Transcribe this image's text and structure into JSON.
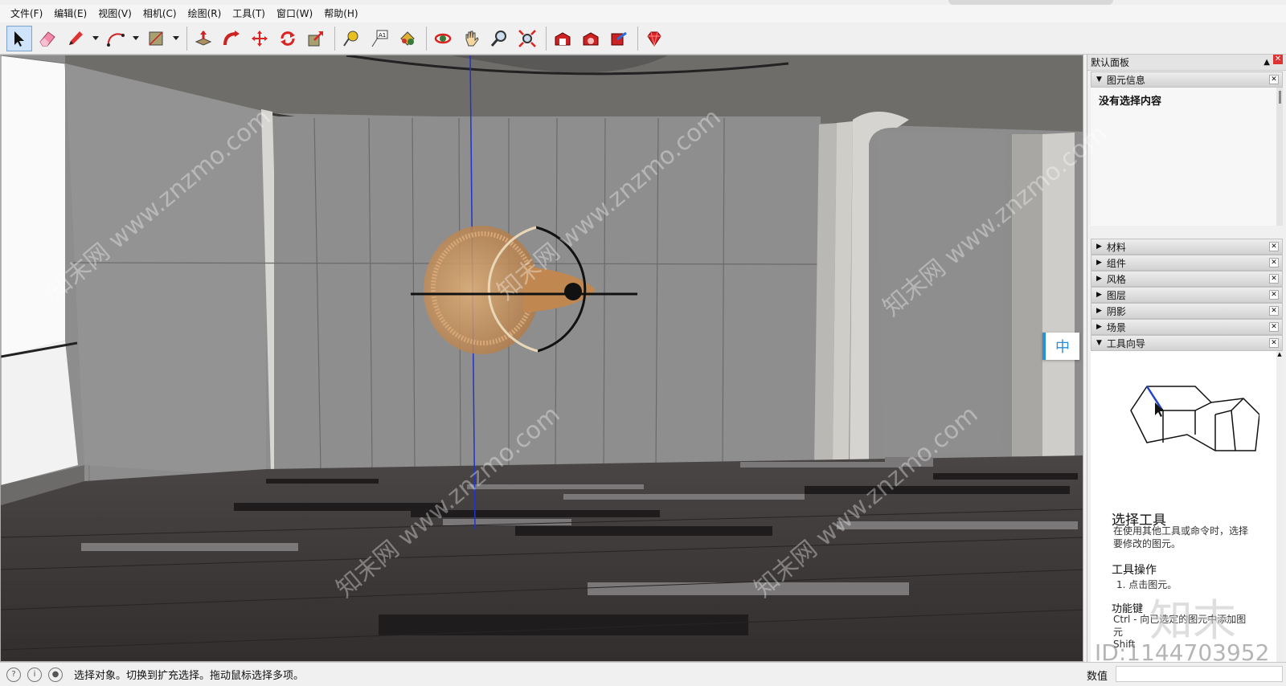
{
  "menu": {
    "items": [
      "文件(F)",
      "编辑(E)",
      "视图(V)",
      "相机(C)",
      "绘图(R)",
      "工具(T)",
      "窗口(W)",
      "帮助(H)"
    ]
  },
  "toolbar": {
    "tools": [
      {
        "name": "select-tool",
        "icon": "arrow-cursor-icon",
        "active": true
      },
      {
        "name": "eraser-tool",
        "icon": "eraser-icon"
      },
      {
        "name": "line-tool",
        "icon": "pencil-icon",
        "dropdown": true
      },
      {
        "name": "arc-tool",
        "icon": "arc-icon",
        "dropdown": true
      },
      {
        "name": "rectangle-tool",
        "icon": "rectangle-icon",
        "dropdown": true
      },
      {
        "name": "push-pull-tool",
        "icon": "push-pull-icon"
      },
      {
        "name": "follow-me-tool",
        "icon": "follow-me-icon"
      },
      {
        "name": "move-tool",
        "icon": "move-icon"
      },
      {
        "name": "rotate-tool",
        "icon": "rotate-icon"
      },
      {
        "name": "scale-tool",
        "icon": "scale-icon"
      },
      {
        "name": "tape-measure-tool",
        "icon": "tape-measure-icon"
      },
      {
        "name": "text-tool",
        "icon": "text-icon"
      },
      {
        "name": "paint-bucket-tool",
        "icon": "paint-bucket-icon"
      },
      {
        "name": "orbit-tool",
        "icon": "orbit-icon"
      },
      {
        "name": "pan-tool",
        "icon": "hand-icon"
      },
      {
        "name": "zoom-tool",
        "icon": "magnifier-icon"
      },
      {
        "name": "zoom-extents-tool",
        "icon": "zoom-extents-icon"
      },
      {
        "name": "warehouse-tool",
        "icon": "warehouse-icon"
      },
      {
        "name": "extension-warehouse-tool",
        "icon": "extension-warehouse-icon"
      },
      {
        "name": "share-model-tool",
        "icon": "share-model-icon"
      },
      {
        "name": "ruby-tool",
        "icon": "ruby-icon"
      }
    ]
  },
  "viewport": {
    "ime_badge": "中"
  },
  "panel": {
    "title": "默认面板",
    "entity_info": {
      "title": "图元信息",
      "message": "没有选择内容"
    },
    "trays": [
      "材料",
      "组件",
      "风格",
      "图层",
      "阴影",
      "场景"
    ],
    "instructor": {
      "title": "工具向导",
      "heading": "选择工具",
      "description": "在使用其他工具或命令时，选择要修改的图元。",
      "operations_heading": "工具操作",
      "step1": "1. 点击图元。",
      "keys_heading": "功能键",
      "ctrl_text": "Ctrl - 向已选定的图元中添加图元",
      "shift_text": "Shift"
    }
  },
  "status": {
    "text": "选择对象。切换到扩充选择。拖动鼠标选择多项。",
    "vcb_label": "数值"
  },
  "watermark": {
    "text": "知末网 www.znzmo.com",
    "logo": "知末",
    "id": "ID:1144703952"
  },
  "colors": {
    "active_tool_bg": "#cfe4fb",
    "ime_accent": "#2a8fd8",
    "close_red": "#dd3333"
  }
}
